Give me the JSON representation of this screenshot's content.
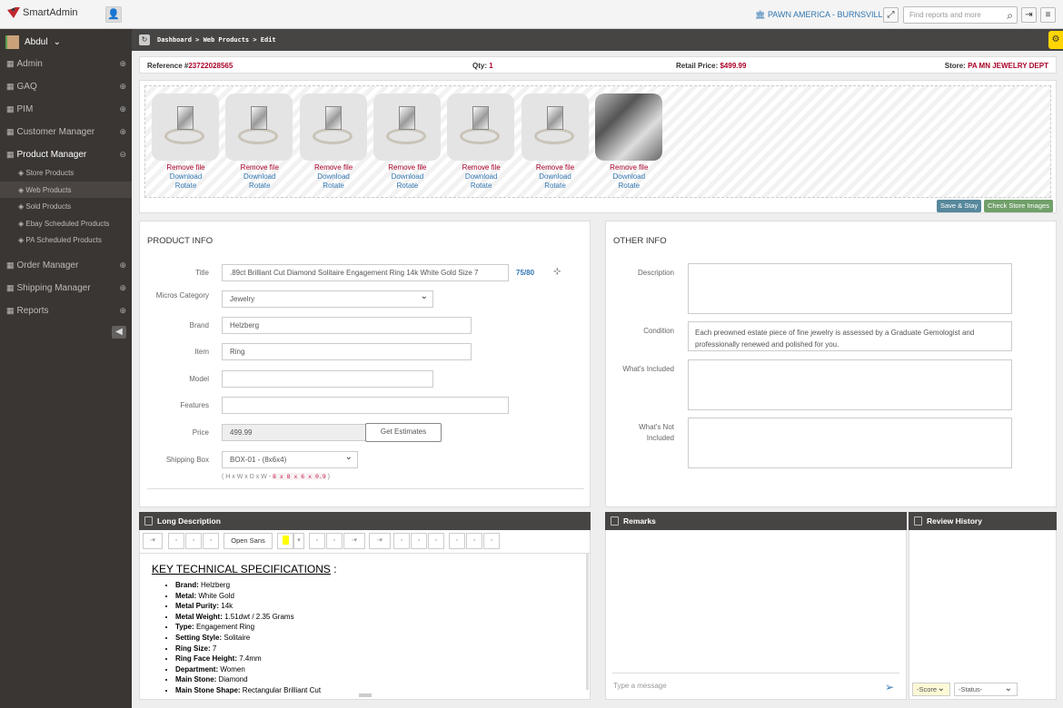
{
  "header": {
    "logo_text": "SmartAdmin",
    "store_selector": "PAWN AMERICA - BURNSVILLE",
    "search_placeholder": "Find reports and more"
  },
  "sidebar": {
    "user": "Abdul",
    "items": [
      {
        "label": "Admin"
      },
      {
        "label": "GAQ"
      },
      {
        "label": "PIM"
      },
      {
        "label": "Customer Manager"
      },
      {
        "label": "Product Manager"
      },
      {
        "label": "Order Manager"
      },
      {
        "label": "Shipping Manager"
      },
      {
        "label": "Reports"
      }
    ],
    "sub_items": [
      {
        "label": "Store Products"
      },
      {
        "label": "Web Products"
      },
      {
        "label": "Sold Products"
      },
      {
        "label": "Ebay Scheduled Products"
      },
      {
        "label": "PA Scheduled Products"
      }
    ]
  },
  "breadcrumb": "Dashboard > Web Products > Edit",
  "reference": {
    "ref_label": "Reference #",
    "ref_value": "23722028565",
    "qty_label": "Qty:",
    "qty_value": "1",
    "price_label": "Retail Price:",
    "price_value": "$499.99",
    "store_label": "Store:",
    "store_value": "PA MN JEWELRY DEPT"
  },
  "images": {
    "actions": {
      "remove": "Remove file",
      "download": "Download",
      "rotate": "Rotate"
    },
    "count": 7,
    "save_stay": "Save & Stay",
    "check_store_images": "Check Store Images"
  },
  "product_info": {
    "title": "PRODUCT INFO",
    "title_label": "Title",
    "title_value": ".89ct Brilliant Cut Diamond Solitaire Engagement Ring 14k White Gold Size 7",
    "title_count": "75/80",
    "category_label": "Micros Category",
    "category_value": "Jewelry",
    "brand_label": "Brand",
    "brand_value": "Helzberg",
    "item_label": "Item",
    "item_value": "Ring",
    "model_label": "Model",
    "model_value": "",
    "features_label": "Features",
    "features_value": "",
    "price_label": "Price",
    "price_value": "499.99",
    "estimates_btn": "Get Estimates",
    "shipping_label": "Shipping Box",
    "shipping_value": "BOX-01 - (8x6x4)",
    "dims_hint": "( H x W x D x W - ",
    "dims_code": "8 x 8 x 6 x 0.9",
    "dims_close": " )"
  },
  "other_info": {
    "title": "OTHER INFO",
    "description_label": "Description",
    "description_value": "",
    "condition_label": "Condition",
    "condition_value": "Each preowned estate piece of fine jewelry is assessed by a Graduate Gemologist and professionally renewed and polished for you.",
    "included_label": "What's Included",
    "not_included_label_1": "What's Not",
    "not_included_label_2": "Included"
  },
  "long_description": {
    "header": "Long Description",
    "font_name": "Open Sans",
    "heading": "KEY TECHNICAL SPECIFICATIONS",
    "heading_suffix": " :",
    "specs": [
      {
        "k": "Brand:",
        "v": " Helzberg"
      },
      {
        "k": "Metal:",
        "v": " White Gold"
      },
      {
        "k": "Metal Purity:",
        "v": " 14k"
      },
      {
        "k": "Metal Weight:",
        "v": " 1.51dwt / 2.35 Grams"
      },
      {
        "k": "Type:",
        "v": " Engagement Ring"
      },
      {
        "k": "Setting Style:",
        "v": " Solitaire"
      },
      {
        "k": "Ring Size:",
        "v": " 7"
      },
      {
        "k": "Ring Face Height:",
        "v": " 7.4mm"
      },
      {
        "k": "Department:",
        "v": " Women"
      },
      {
        "k": "Main Stone:",
        "v": " Diamond"
      },
      {
        "k": "Main Stone Shape:",
        "v": " Rectangular Brilliant Cut"
      }
    ]
  },
  "remarks": {
    "header": "Remarks",
    "message_placeholder": "Type a message"
  },
  "review_history": {
    "header": "Review History",
    "score": "-Score",
    "status": "-Status-"
  },
  "colors": {
    "accent_red": "#a90329",
    "link_blue": "#3276b1",
    "save_btn": "#57889c",
    "check_btn": "#71a06a"
  }
}
